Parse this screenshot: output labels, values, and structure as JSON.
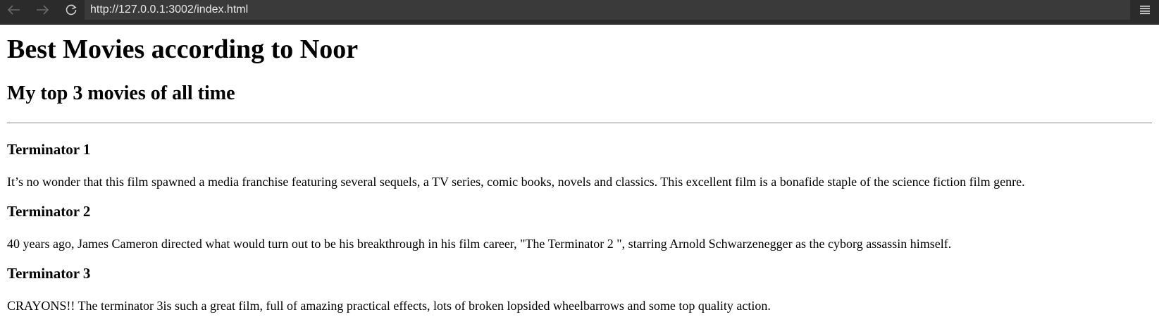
{
  "browser": {
    "url": "http://127.0.0.1:3002/index.html",
    "icons": [
      "back-arrow-icon",
      "forward-arrow-icon",
      "reload-icon",
      "hamburger-menu-icon"
    ]
  },
  "page": {
    "title": "Best Movies according to Noor",
    "subtitle": "My top 3 movies of all time",
    "movies": [
      {
        "name": "Terminator 1",
        "description": "It’s no wonder that this film spawned a media franchise featuring several sequels, a TV series, comic books, novels and classics. This excellent film is a bonafide staple of the science fiction film genre."
      },
      {
        "name": "Terminator 2",
        "description": "40 years ago, James Cameron directed what would turn out to be his breakthrough in his film career, \"The Terminator 2 \", starring Arnold Schwarzenegger as the cyborg assassin himself."
      },
      {
        "name": "Terminator 3",
        "description": "CRAYONS!! The terminator 3is such a great film, full of amazing practical effects, lots of broken lopsided wheelbarrows and some top quality action."
      }
    ]
  },
  "colors": {
    "toolbar": "#2b2b2b",
    "url_field": "#3a3a3a",
    "url_text": "#e6e6e6",
    "page_bg": "#ffffff",
    "text": "#000000"
  }
}
